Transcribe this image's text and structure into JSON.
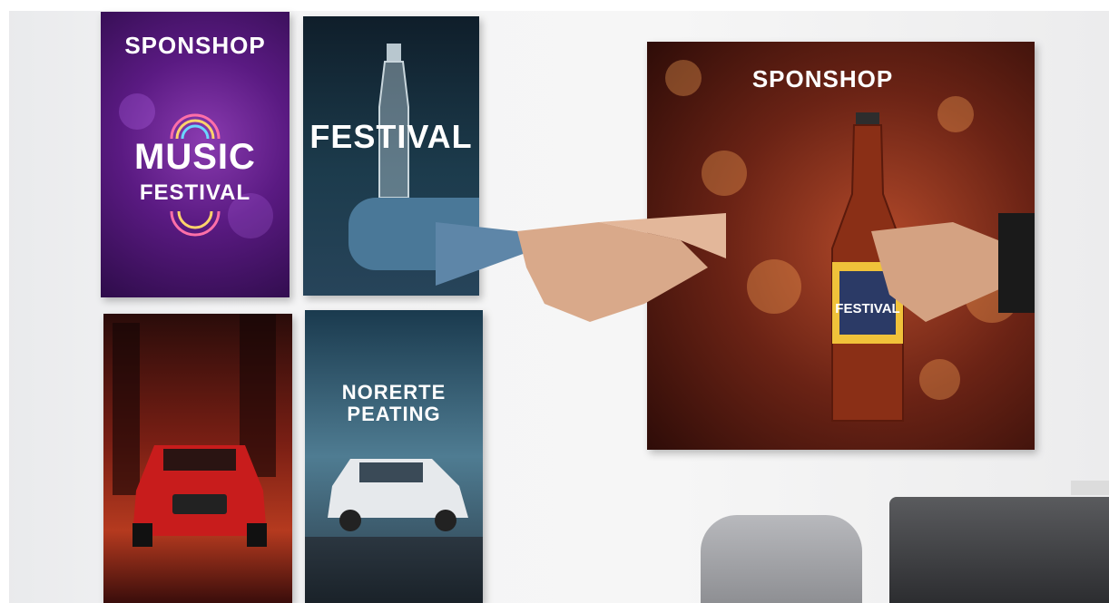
{
  "scene": {
    "posters": [
      {
        "name": "purple-music-poster",
        "heading": "SPONSHOP",
        "line1": "MUSIC",
        "line2": "FESTIVAL"
      },
      {
        "name": "bottle-festival-poster",
        "heading": "FESTIVAL"
      },
      {
        "name": "red-car-poster"
      },
      {
        "name": "white-car-poster",
        "line1": "NORERTE",
        "line2": "PEATING"
      }
    ],
    "banner": {
      "heading": "SPONSHOP",
      "bottle_label": "FESTIVAL"
    }
  },
  "colors": {
    "wall": "#f2f2f2",
    "purple": "#5a1a82",
    "teal": "#1c3b4c",
    "red": "#b53a1f",
    "amber": "#b44a2a"
  }
}
